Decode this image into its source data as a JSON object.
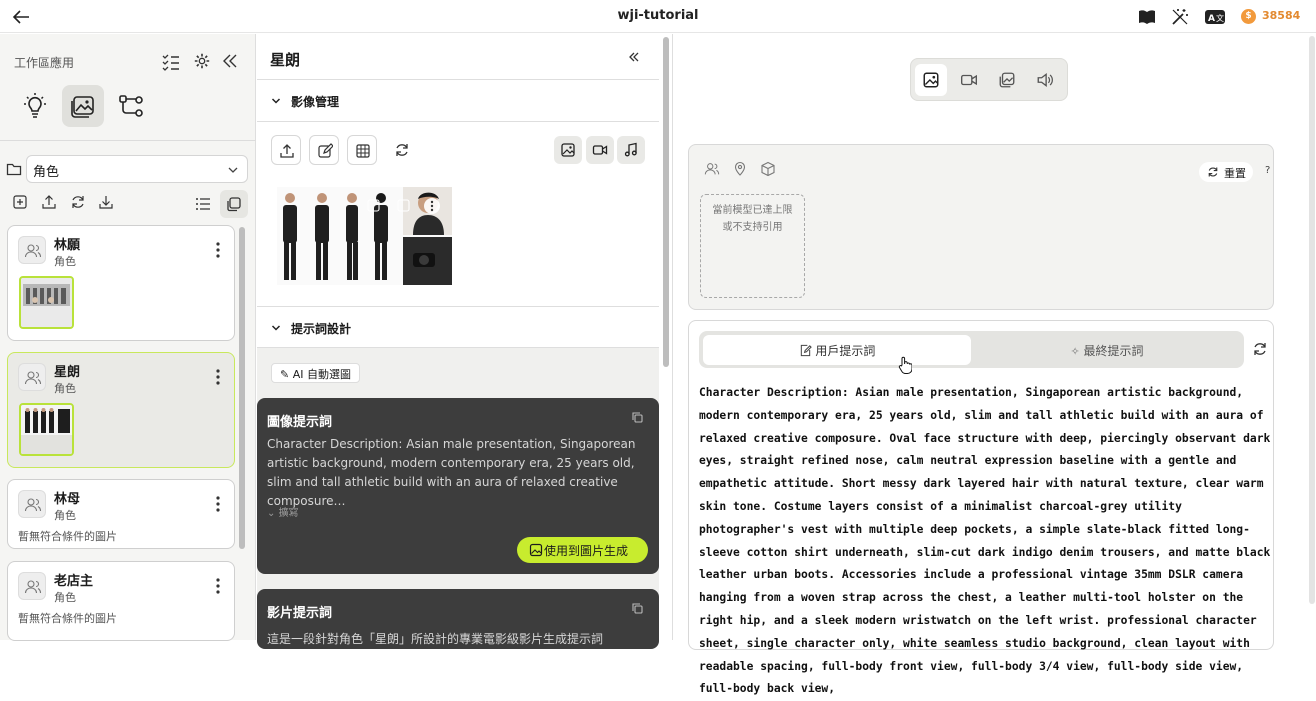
{
  "topbar": {
    "title": "wji-tutorial",
    "credits": "38584",
    "coin_symbol": "$"
  },
  "left": {
    "title": "工作區應用",
    "category": "角色",
    "cards": [
      {
        "name": "林願",
        "type": "角色",
        "empty": ""
      },
      {
        "name": "星朗",
        "type": "角色",
        "empty": ""
      },
      {
        "name": "林母",
        "type": "角色",
        "empty": "暫無符合條件的圖片"
      },
      {
        "name": "老店主",
        "type": "角色",
        "empty": "暫無符合條件的圖片"
      }
    ]
  },
  "middle": {
    "title": "星朗",
    "section_image": "影像管理",
    "section_prompt": "提示詞設計",
    "ai_button": "AI 自動選圖",
    "image_prompt": {
      "title": "圖像提示詞",
      "text": "Character Description: Asian male presentation, Singaporean artistic background, modern contemporary era, 25 years old, slim and tall athletic build with an aura of relaxed creative composure…",
      "expand": "擴寫",
      "use_button": "使用到圖片生成"
    },
    "video_prompt": {
      "title": "影片提示詞",
      "text": "這是一段針對角色「星朗」所設計的專業電影級影片生成提示詞"
    }
  },
  "right": {
    "reset": "重置",
    "help": "?",
    "limit_line1": "當前模型已達上限",
    "limit_line2": "或不支持引用",
    "tab_user": "用戶提示詞",
    "tab_final": "最終提示詞",
    "prompt_text": "Character Description: Asian male presentation, Singaporean artistic background, modern contemporary era, 25 years old, slim and tall athletic build with an aura of relaxed creative composure. Oval face structure with deep, piercingly observant dark eyes, straight refined nose, calm neutral expression baseline with a gentle and empathetic attitude. Short messy dark layered hair with natural texture, clear warm skin tone. Costume layers consist of a minimalist charcoal-grey utility photographer's vest with multiple deep pockets, a simple slate-black fitted long-sleeve cotton shirt underneath, slim-cut dark indigo denim trousers, and matte black leather urban boots. Accessories include a professional vintage 35mm DSLR camera hanging from a woven strap across the chest, a leather multi-tool holster on the right hip, and a sleek modern wristwatch on the left wrist. professional character sheet, single character only, white seamless studio background, clean layout with readable spacing, full-body front view, full-body 3/4 view, full-body side view, full-body back view,"
  },
  "colors": {
    "accent": "#c8ec2e",
    "selected_border": "#b9e23a",
    "dark_box": "#3d3d3d",
    "coin": "#f29a3c"
  }
}
